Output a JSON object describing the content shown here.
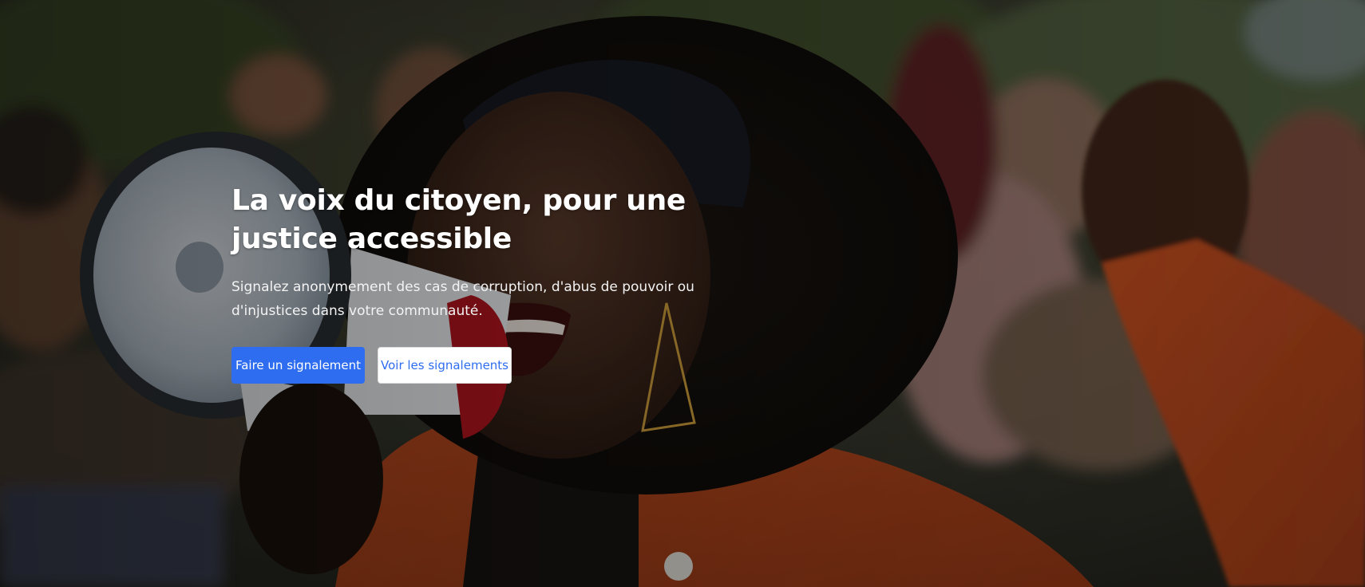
{
  "hero": {
    "title": "La voix du citoyen, pour une justice accessible",
    "subtitle": "Signalez anonymement des cas de corruption, d'abus de pouvoir ou d'injustices dans votre communauté.",
    "primary_button_label": "Faire un signalement",
    "secondary_button_label": "Voir les signalements",
    "background_image": "protest-woman-megaphone-photo"
  },
  "colors": {
    "accent": "#2f6df0",
    "secondary_button_bg": "#ffffff",
    "text": "#ffffff"
  }
}
